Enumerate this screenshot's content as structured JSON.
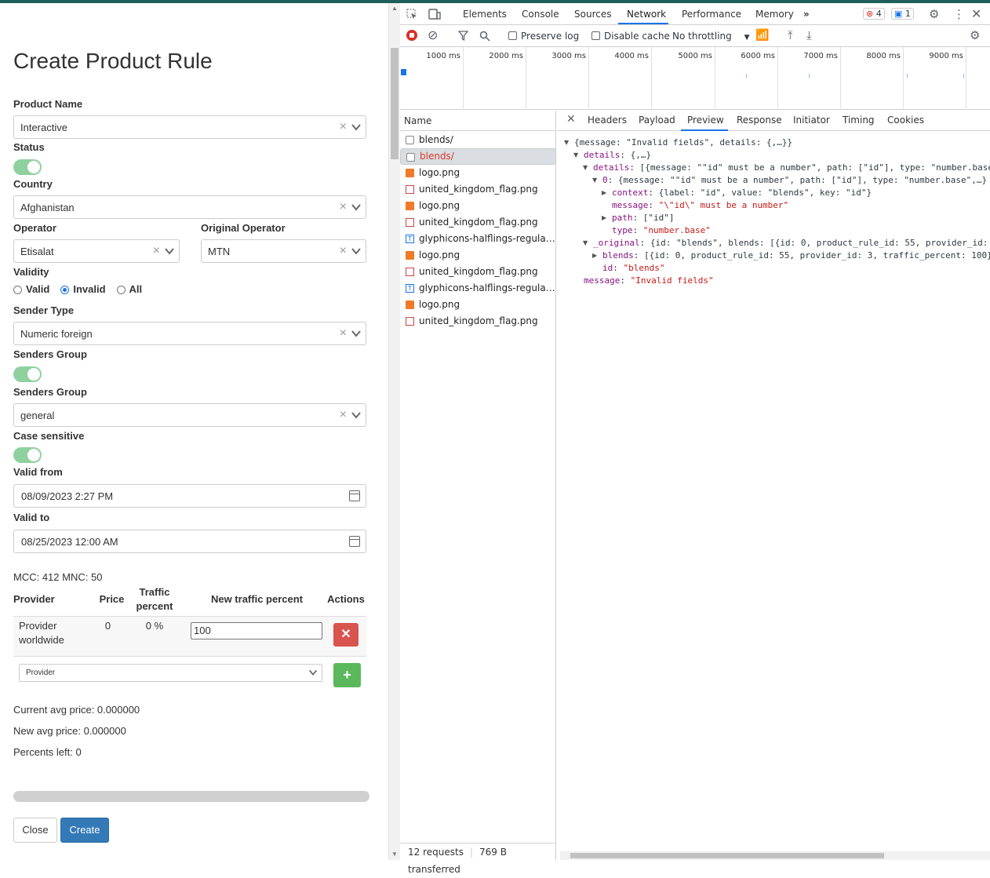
{
  "form": {
    "title": "Create Product Rule",
    "product_name_label": "Product Name",
    "product_name_value": "Interactive",
    "status_label": "Status",
    "country_label": "Country",
    "country_value": "Afghanistan",
    "operator_label": "Operator",
    "operator_value": "Etisalat",
    "original_operator_label": "Original Operator",
    "original_operator_value": "MTN",
    "validity_label": "Validity",
    "validity_options": [
      "Valid",
      "Invalid",
      "All"
    ],
    "validity_selected": "Invalid",
    "sender_type_label": "Sender Type",
    "sender_type_value": "Numeric foreign",
    "senders_group_toggle_label": "Senders Group",
    "senders_group_label": "Senders Group",
    "senders_group_value": "general",
    "case_sensitive_label": "Case sensitive",
    "valid_from_label": "Valid from",
    "valid_from_value": "08/09/2023 2:27 PM",
    "valid_to_label": "Valid to",
    "valid_to_value": "08/25/2023 12:00 AM",
    "mcc_mnc": "MCC: 412 MNC: 50",
    "table_headers": {
      "provider": "Provider",
      "price": "Price",
      "traffic_percent": "Traffic percent",
      "new_traffic_percent": "New traffic percent",
      "actions": "Actions"
    },
    "row": {
      "provider": "Provider worldwide",
      "price": "0",
      "traffic": "0 %",
      "new_traffic": "100",
      "delete_symbol": "✕"
    },
    "provider_select_placeholder": "Provider",
    "add_symbol": "+",
    "current_avg_price": "Current avg price: 0.000000",
    "new_avg_price": "New avg price: 0.000000",
    "percents_left": "Percents left: 0",
    "close_label": "Close",
    "create_label": "Create"
  },
  "devtools": {
    "tabs": [
      "Elements",
      "Console",
      "Sources",
      "Network",
      "Performance",
      "Memory"
    ],
    "active_tab": "Network",
    "error_count": "4",
    "message_count": "1",
    "toolbar": {
      "preserve_log": "Preserve log",
      "disable_cache": "Disable cache",
      "throttling": "No throttling"
    },
    "timeline_ticks": [
      "1000 ms",
      "2000 ms",
      "3000 ms",
      "4000 ms",
      "5000 ms",
      "6000 ms",
      "7000 ms",
      "8000 ms",
      "9000 ms"
    ],
    "name_header": "Name",
    "requests": [
      {
        "name": "blends/",
        "type": "doc"
      },
      {
        "name": "blends/",
        "type": "doc",
        "error": true,
        "selected": true
      },
      {
        "name": "logo.png",
        "type": "img"
      },
      {
        "name": "united_kingdom_flag.png",
        "type": "flag"
      },
      {
        "name": "logo.png",
        "type": "img"
      },
      {
        "name": "united_kingdom_flag.png",
        "type": "flag"
      },
      {
        "name": "glyphicons-halflings-regular....",
        "type": "font"
      },
      {
        "name": "logo.png",
        "type": "img"
      },
      {
        "name": "united_kingdom_flag.png",
        "type": "flag"
      },
      {
        "name": "glyphicons-halflings-regular....",
        "type": "font"
      },
      {
        "name": "logo.png",
        "type": "img"
      },
      {
        "name": "united_kingdom_flag.png",
        "type": "flag"
      }
    ],
    "status_requests": "12 requests",
    "status_transferred": "769 B transferred",
    "detail_tabs": [
      "Headers",
      "Payload",
      "Preview",
      "Response",
      "Initiator",
      "Timing",
      "Cookies"
    ],
    "active_detail_tab": "Preview",
    "preview": {
      "l1": "{message: \"Invalid fields\", details: {,…}}",
      "l2_key": "details",
      "l2_val": "{,…}",
      "l3_key": "details",
      "l3_val": "[{message: \"\"id\" must be a number\", path: [\"id\"], type: \"number.base",
      "l4_key": "0",
      "l4_val": "{message: \"\"id\" must be a number\", path: [\"id\"], type: \"number.base\",…}",
      "l5_key": "context",
      "l5_val": "{label: \"id\", value: \"blends\", key: \"id\"}",
      "l6_key": "message",
      "l6_val": "\"\\\"id\\\" must be a number\"",
      "l7_key": "path",
      "l7_val": "[\"id\"]",
      "l8_key": "type",
      "l8_val": "\"number.base\"",
      "l9_key": "_original",
      "l9_val": "{id: \"blends\", blends: [{id: 0, product_rule_id: 55, provider_id:",
      "l10_key": "blends",
      "l10_val": "[{id: 0, product_rule_id: 55, provider_id: 3, traffic_percent: 100}",
      "l11_key": "id",
      "l11_val": "\"blends\"",
      "l12_key": "message",
      "l12_val": "\"Invalid fields\""
    }
  }
}
